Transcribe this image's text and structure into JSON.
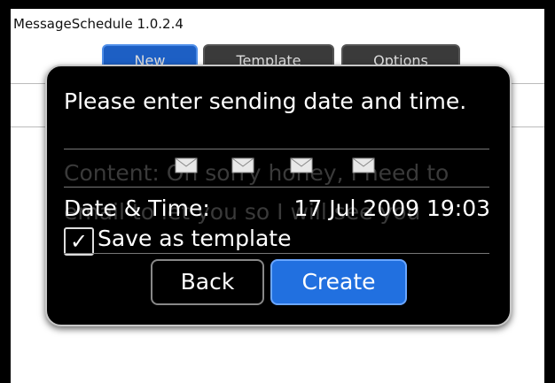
{
  "app": {
    "title": "MessageSchedule 1.0.2.4"
  },
  "tabs": [
    {
      "label": "New"
    },
    {
      "label": "Template"
    },
    {
      "label": "Options"
    }
  ],
  "background": {
    "content_ghost": "Content: Oh sorry honey, I need to",
    "content_ghost2": "email to let you so I will see you"
  },
  "dialog": {
    "prompt": "Please enter sending date and time.",
    "datetime_label": "Date & Time:",
    "datetime_value": "17 Jul 2009 19:03",
    "checkbox_glyph": "✓",
    "save_label": "Save as template",
    "back_label": "Back",
    "create_label": "Create"
  },
  "colors": {
    "accent": "#2170e0",
    "dialog_bg": "#000000",
    "text": "#ffffff"
  },
  "icons": [
    "envelope-icon",
    "envelope-icon",
    "envelope-icon",
    "envelope-icon"
  ]
}
